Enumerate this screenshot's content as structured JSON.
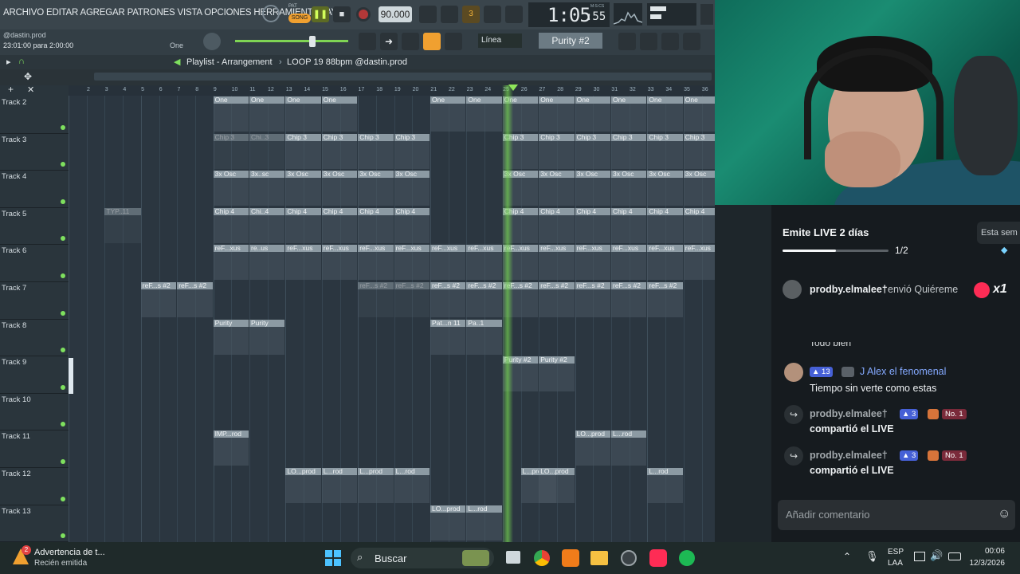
{
  "fl": {
    "menu": "ARCHIVO EDITAR AGREGAR PATRONES VISTA OPCIONES HERRAMIENTAS AYU",
    "pat_label": "PAT",
    "song_label": "SONG",
    "tempo": "90.000",
    "time_main": "1:05",
    "time_sub": ":55",
    "time_unit": "M:S:CS",
    "user_hint": "@dastin.prod",
    "hint_time": "23:01:00 para 2:00:00",
    "hint_one": "One",
    "snap": "Línea",
    "pattern": "Purity #2",
    "playlist_title": "Playlist - Arrangement",
    "playlist_sub": "LOOP 19 88bpm @dastin.prod",
    "ruler_numbers": [
      "2",
      "3",
      "4",
      "5",
      "6",
      "7",
      "8",
      "9",
      "10",
      "11",
      "12",
      "13",
      "14",
      "15",
      "16",
      "17",
      "18",
      "19",
      "20",
      "21",
      "22",
      "23",
      "24",
      "25",
      "26",
      "27",
      "28",
      "29",
      "30",
      "31",
      "32",
      "33",
      "34",
      "35",
      "36"
    ],
    "tracks": [
      "Track 2",
      "Track 3",
      "Track 4",
      "Track 5",
      "Track 6",
      "Track 7",
      "Track 8",
      "Track 9",
      "Track 10",
      "Track 11",
      "Track 12",
      "Track 13"
    ],
    "clips": {
      "t2": [
        "One",
        "One",
        "One",
        "One",
        "One",
        "One",
        "One",
        "One",
        "One",
        "One",
        "One",
        "One",
        "One"
      ],
      "t3": [
        "Chip 3",
        "Chi..3",
        "Chip 3",
        "Chip 3",
        "Chip 3",
        "Chip 3",
        "Chip 3",
        "Chip 3",
        "Chip 3",
        "Chip 3",
        "Chip 3",
        "Chip 3"
      ],
      "t4": [
        "3x Osc",
        "3x..sc",
        "3x Osc",
        "3x Osc",
        "3x Osc",
        "3x Osc",
        "3x Osc",
        "3x Osc",
        "3x Osc",
        "3x Osc",
        "3x Osc",
        "3x Osc"
      ],
      "t5_auto": "TYP..11",
      "t5": [
        "Chip 4",
        "Chi..4",
        "Chip 4",
        "Chip 4",
        "Chip 4",
        "Chip 4",
        "Chip 4",
        "Chip 4",
        "Chip 4",
        "Chip 4",
        "Chip 4",
        "Chip 4"
      ],
      "t6": [
        "reF...xus",
        "re..us",
        "reF...xus",
        "reF...xus",
        "reF...xus",
        "reF...xus",
        "reF...xus",
        "reF...xus",
        "reF...xus",
        "reF...xus",
        "reF...xus",
        "reF...xus",
        "reF...xus",
        "reF...xus"
      ],
      "t7": [
        "reF...s #2",
        "reF...s #2",
        "reF...s #2",
        "reF...s #2",
        "reF...s #2",
        "reF...s #2",
        "reF...s #2",
        "reF...s #2",
        "reF...s #2",
        "reF...s #2",
        "reF...s #2"
      ],
      "t8": [
        "Purity",
        "Purity",
        "Pat...n 11",
        "Pa..1"
      ],
      "t9": [
        "Purity #2",
        "Purity #2"
      ],
      "t11": [
        "IMP...rod",
        "LO...prod",
        "L...rod"
      ],
      "t12": [
        "LO...prod",
        "L...rod",
        "L...prod",
        "L...rod",
        "L...prod",
        "LO...prod",
        "L...rod"
      ],
      "t13": [
        "LO...prod",
        "L...rod"
      ]
    }
  },
  "live": {
    "goal_title": "Emite LIVE 2 días",
    "goal_progress_text": "1/2",
    "goal_progress": 0.5,
    "right_tab": "Esta sem",
    "gift_user": "prodby.elmalee†",
    "gift_text": "envió Quiéreme",
    "gift_count": "x1",
    "partial_text": "Todo bien",
    "comments": [
      {
        "level": "13",
        "user": "J Alex el fenomenal",
        "text": "Tiempo sin verte como estas"
      },
      {
        "user": "prodby.elmalee†",
        "level": "3",
        "badge": "No. 1",
        "text": "compartió el LIVE"
      },
      {
        "user": "prodby.elmalee†",
        "level": "3",
        "badge": "No. 1",
        "text": "compartió el LIVE"
      }
    ],
    "input_placeholder": "Añadir comentario"
  },
  "taskbar": {
    "notif_title": "Advertencia de t...",
    "notif_sub": "Recién emitida",
    "notif_count": "2",
    "search": "Buscar",
    "lang_1": "ESP",
    "lang_2": "LAA",
    "clock_time": "00:06",
    "clock_date": "12/3/2026"
  },
  "colors": {
    "accent_green": "#7ee05e",
    "tiktok_red": "#fe2c55",
    "fl_orange": "#f0a030"
  }
}
